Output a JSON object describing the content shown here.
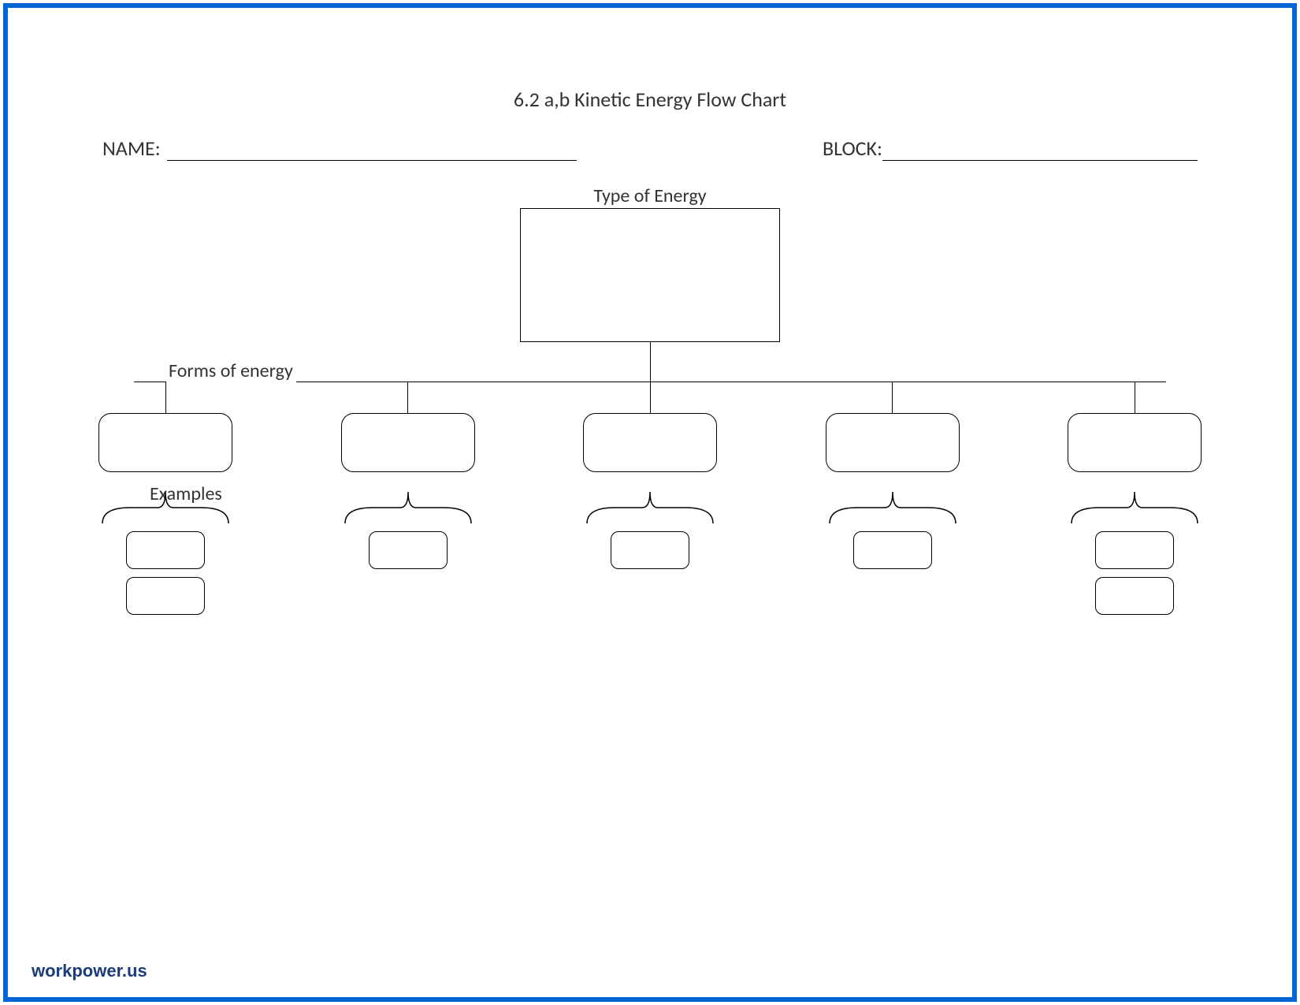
{
  "title": "6.2 a,b Kinetic Energy Flow Chart",
  "labels": {
    "name": "NAME:",
    "block": "BLOCK:",
    "type_of_energy": "Type of Energy",
    "forms_of_energy": "Forms of energy",
    "examples": "Examples"
  },
  "branches": [
    {
      "examples_count": 2
    },
    {
      "examples_count": 1
    },
    {
      "examples_count": 1
    },
    {
      "examples_count": 1
    },
    {
      "examples_count": 2
    }
  ],
  "watermark": "workpower.us"
}
